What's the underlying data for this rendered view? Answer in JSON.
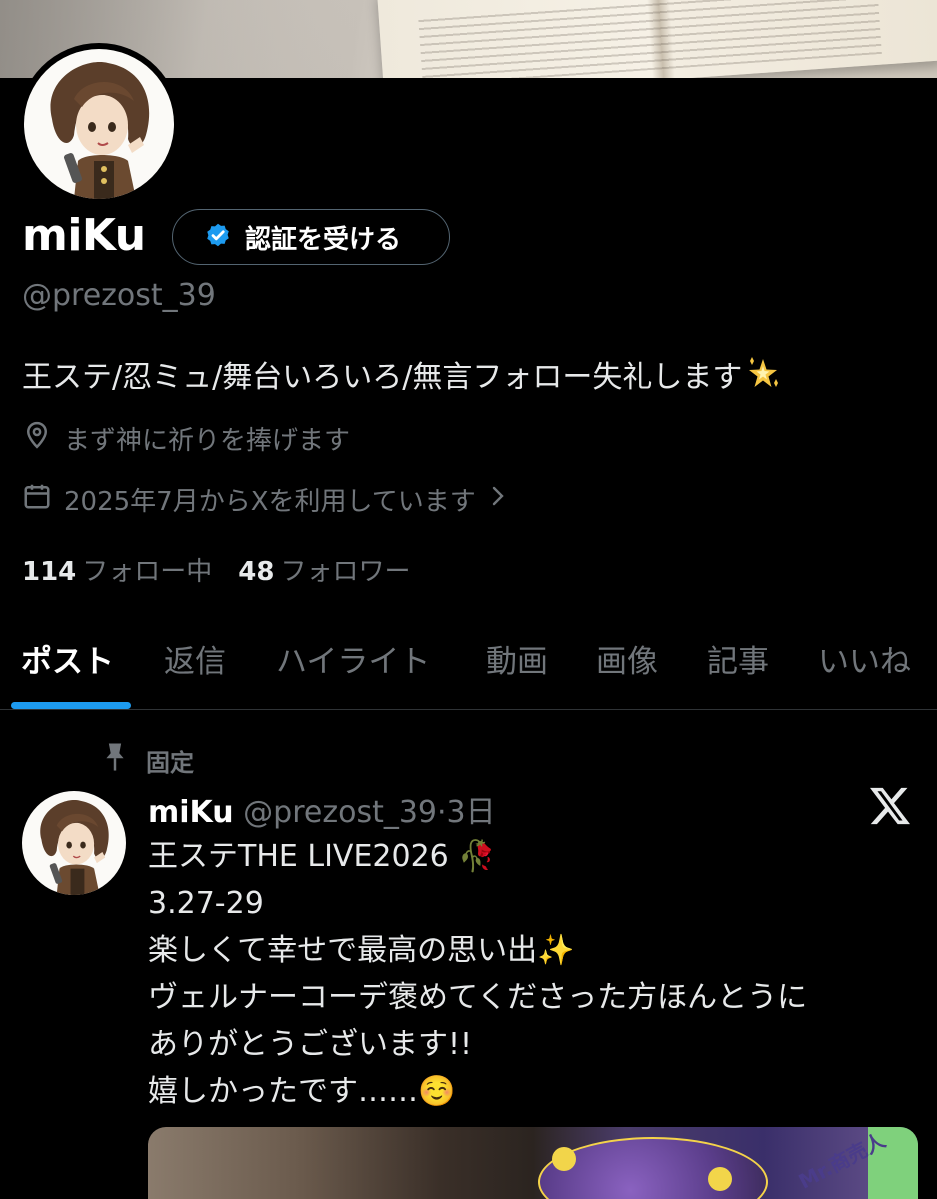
{
  "profile": {
    "display_name": "miKu",
    "verify_label": "認証を受ける",
    "handle": "@prezost_39",
    "bio": "王ステ/忍ミュ/舞台いろいろ/無言フォロー失礼します",
    "location": "まず神に祈りを捧げます",
    "joined": "2025年7月からXを利用しています",
    "following_count": "114",
    "following_label": "フォロー中",
    "followers_count": "48",
    "followers_label": "フォロワー"
  },
  "tabs": [
    {
      "label": "ポスト",
      "active": true
    },
    {
      "label": "返信",
      "active": false
    },
    {
      "label": "ハイライト",
      "active": false
    },
    {
      "label": "動画",
      "active": false
    },
    {
      "label": "画像",
      "active": false
    },
    {
      "label": "記事",
      "active": false
    },
    {
      "label": "いいね",
      "active": false
    }
  ],
  "pinned_post": {
    "pinned_label": "固定",
    "author_name": "miKu",
    "author_handle": "@prezost_39",
    "time": "·3日",
    "lines": [
      "王ステTHE LIVE2026 🥀",
      "3.27-29",
      "楽しくて幸せで最高の思い出✨",
      "ヴェルナーコーデ褒めてくださった方ほんとうに",
      "ありがとうございます!!",
      "嬉しかったです……☺️"
    ],
    "media_badge_text": "Mr.商売人"
  },
  "colors": {
    "background": "#000000",
    "accent": "#1d9bf0",
    "muted": "#71767b",
    "verified_badge": "#1d9bf0"
  },
  "icons": [
    "verified-badge-icon",
    "location-pin-icon",
    "calendar-icon",
    "chevron-right-icon",
    "pin-icon",
    "x-logo-icon",
    "sparkle-star-emoji"
  ]
}
